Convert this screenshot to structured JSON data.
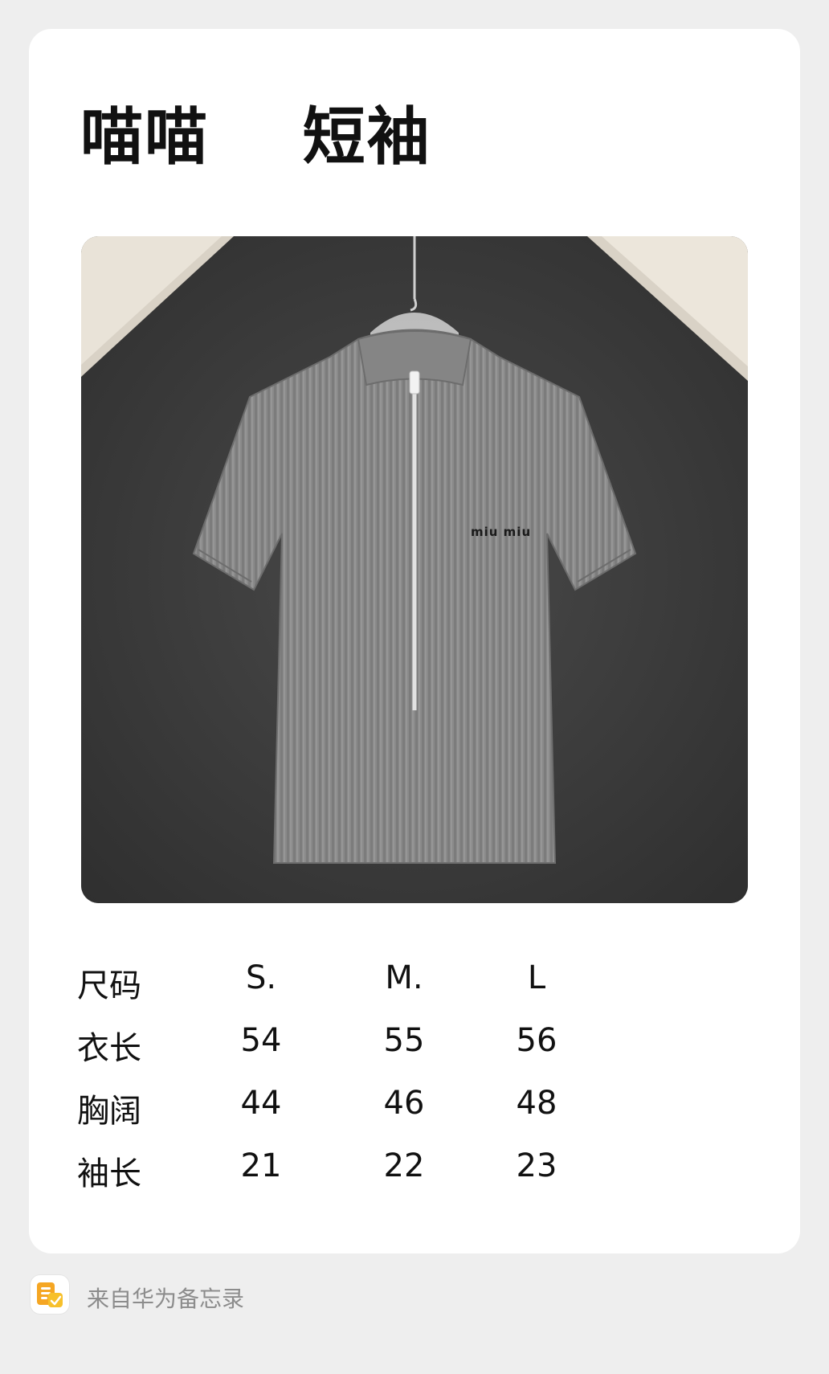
{
  "note": {
    "title": "喵喵    短袖"
  },
  "product_photo": {
    "description": "grey knit short-sleeve half-zip top on hanger",
    "logo_text": "miu miu"
  },
  "size_table": {
    "rows": [
      {
        "label": "尺码",
        "values": [
          "S.",
          "M.",
          "L"
        ]
      },
      {
        "label": "衣长",
        "values": [
          "54",
          "55",
          "56"
        ]
      },
      {
        "label": "胸阔",
        "values": [
          "44",
          "46",
          "48"
        ]
      },
      {
        "label": "袖长",
        "values": [
          "21",
          "22",
          "23"
        ]
      }
    ]
  },
  "footer": {
    "icon": "huawei-notepad-icon",
    "source_text": "来自华为备忘录"
  },
  "colors": {
    "background": "#eeeeee",
    "card": "#ffffff",
    "text": "#111111",
    "footer_text": "#8c8c8c",
    "icon_accent": "#f5a623"
  }
}
